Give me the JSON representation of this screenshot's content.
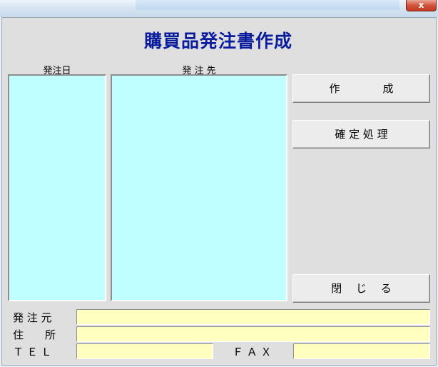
{
  "window": {
    "close_glyph": "x"
  },
  "form": {
    "title": "購買品発注書作成",
    "columns": {
      "order_date_label": "発注日",
      "supplier_label": "発 注 先"
    },
    "order_date_items": [],
    "supplier_items": []
  },
  "buttons": {
    "create": "作　　　　成",
    "confirm": "確 定 処 理",
    "close": "閉　 じ 　る"
  },
  "fields": {
    "orderer_label": "発 注 元",
    "orderer_value": "",
    "address_label": "住　　所",
    "address_value": "",
    "tel_label": "Ｔ Ｅ Ｌ",
    "tel_value": "",
    "fax_label": "Ｆ Ａ Ｘ",
    "fax_value": ""
  },
  "colors": {
    "title": "#0b1c9c",
    "listbox_bg": "#c0ffff",
    "field_bg": "#ffffc0",
    "form_bg": "#dfdfdf"
  }
}
